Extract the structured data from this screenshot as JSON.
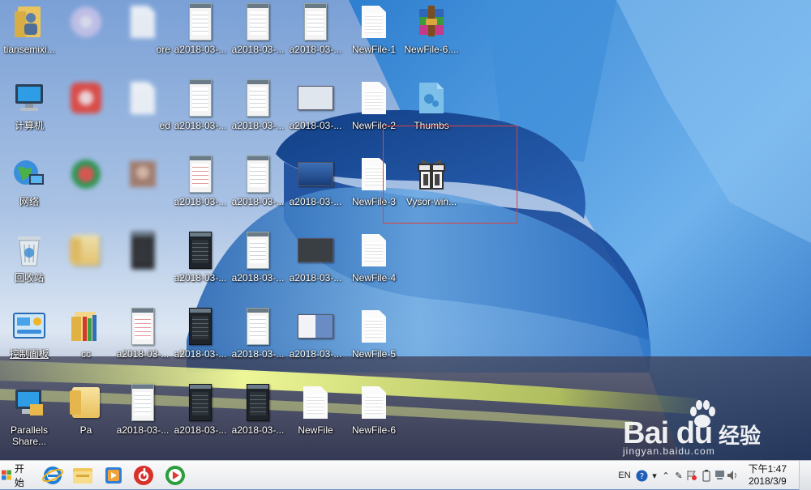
{
  "desktop": {
    "col1": [
      {
        "label": "tiansemixi...",
        "icon": "user-folder-icon"
      },
      {
        "label": "计算机",
        "icon": "computer-icon"
      },
      {
        "label": "网络",
        "icon": "network-globe-icon"
      },
      {
        "label": "回收站",
        "icon": "recycle-bin-icon"
      },
      {
        "label": "控制面板",
        "icon": "control-panel-icon"
      },
      {
        "label": "Parallels",
        "label2": "Share...",
        "icon": "parallels-share-icon"
      }
    ],
    "col2": [
      {
        "label": "",
        "icon": "disc-icon"
      },
      {
        "label": "",
        "icon": "app-icon"
      },
      {
        "label": "",
        "icon": "app-icon"
      },
      {
        "label": "",
        "icon": "folder-icon"
      },
      {
        "label": "cc",
        "icon": "folder-icon"
      },
      {
        "label": "Pa",
        "icon": "folder-icon"
      }
    ],
    "col3": [
      {
        "label": "ore",
        "icon": "file-icon"
      },
      {
        "label": "ed",
        "icon": "file-icon"
      },
      {
        "label": "",
        "icon": "image-icon"
      },
      {
        "label": "",
        "icon": "phone-screenshot-icon"
      },
      {
        "label": "a2018-03-...",
        "icon": "phone-screenshot-icon"
      },
      {
        "label": "a2018-03-...",
        "icon": "phone-screenshot-icon"
      }
    ],
    "col4": [
      {
        "label": "a2018-03-...",
        "icon": "phone-screenshot-icon"
      },
      {
        "label": "a2018-03-...",
        "icon": "phone-screenshot-icon"
      },
      {
        "label": "a2018-03-...",
        "icon": "phone-screenshot-icon"
      },
      {
        "label": "a2018-03-...",
        "icon": "phone-screenshot-icon"
      },
      {
        "label": "a2018-03-...",
        "icon": "phone-screenshot-icon"
      },
      {
        "label": "a2018-03-...",
        "icon": "phone-screenshot-icon"
      }
    ],
    "col5": [
      {
        "label": "a2018-03-...",
        "icon": "phone-screenshot-icon"
      },
      {
        "label": "a2018-03-...",
        "icon": "phone-screenshot-icon"
      },
      {
        "label": "a2018-03-...",
        "icon": "phone-screenshot-icon"
      },
      {
        "label": "a2018-03-...",
        "icon": "phone-screenshot-icon"
      },
      {
        "label": "a2018-03-...",
        "icon": "phone-screenshot-icon"
      },
      {
        "label": "a2018-03-...",
        "icon": "phone-screenshot-icon"
      }
    ],
    "col6": [
      {
        "label": "a2018-03-...",
        "icon": "phone-screenshot-icon"
      },
      {
        "label": "a2018-03-...",
        "icon": "desktop-screenshot-icon"
      },
      {
        "label": "a2018-03-...",
        "icon": "desktop-screenshot-icon"
      },
      {
        "label": "a2018-03-...",
        "icon": "desktop-screenshot-icon"
      },
      {
        "label": "a2018-03-...",
        "icon": "desktop-screenshot-icon"
      },
      {
        "label": "NewFile",
        "icon": "blank-file-icon"
      }
    ],
    "col7": [
      {
        "label": "NewFile-1",
        "icon": "blank-file-icon"
      },
      {
        "label": "NewFile-2",
        "icon": "blank-file-icon"
      },
      {
        "label": "NewFile-3",
        "icon": "blank-file-icon"
      },
      {
        "label": "NewFile-4",
        "icon": "blank-file-icon"
      },
      {
        "label": "NewFile-5",
        "icon": "blank-file-icon"
      },
      {
        "label": "NewFile-6",
        "icon": "blank-file-icon"
      }
    ],
    "col8": [
      {
        "label": "NewFile-6....",
        "icon": "winrar-archive-icon"
      },
      {
        "label": "Thumbs",
        "icon": "thumbs-db-icon"
      },
      {
        "label": "Vysor-win...",
        "icon": "installer-package-icon"
      }
    ]
  },
  "watermark": {
    "brand": "Bai  du",
    "cn": "经验",
    "url": "jingyan.baidu.com"
  },
  "taskbar": {
    "start_label": "开始",
    "apps": [
      "ie-browser-icon",
      "file-explorer-icon",
      "media-player-icon",
      "netease-music-icon",
      "green-player-icon"
    ],
    "tray": {
      "lang": "EN",
      "time": "下午1:47",
      "date": "2018/3/9"
    }
  },
  "colors": {
    "selection_box": "#e04040",
    "taskbar_bg": "#eef0f3"
  }
}
